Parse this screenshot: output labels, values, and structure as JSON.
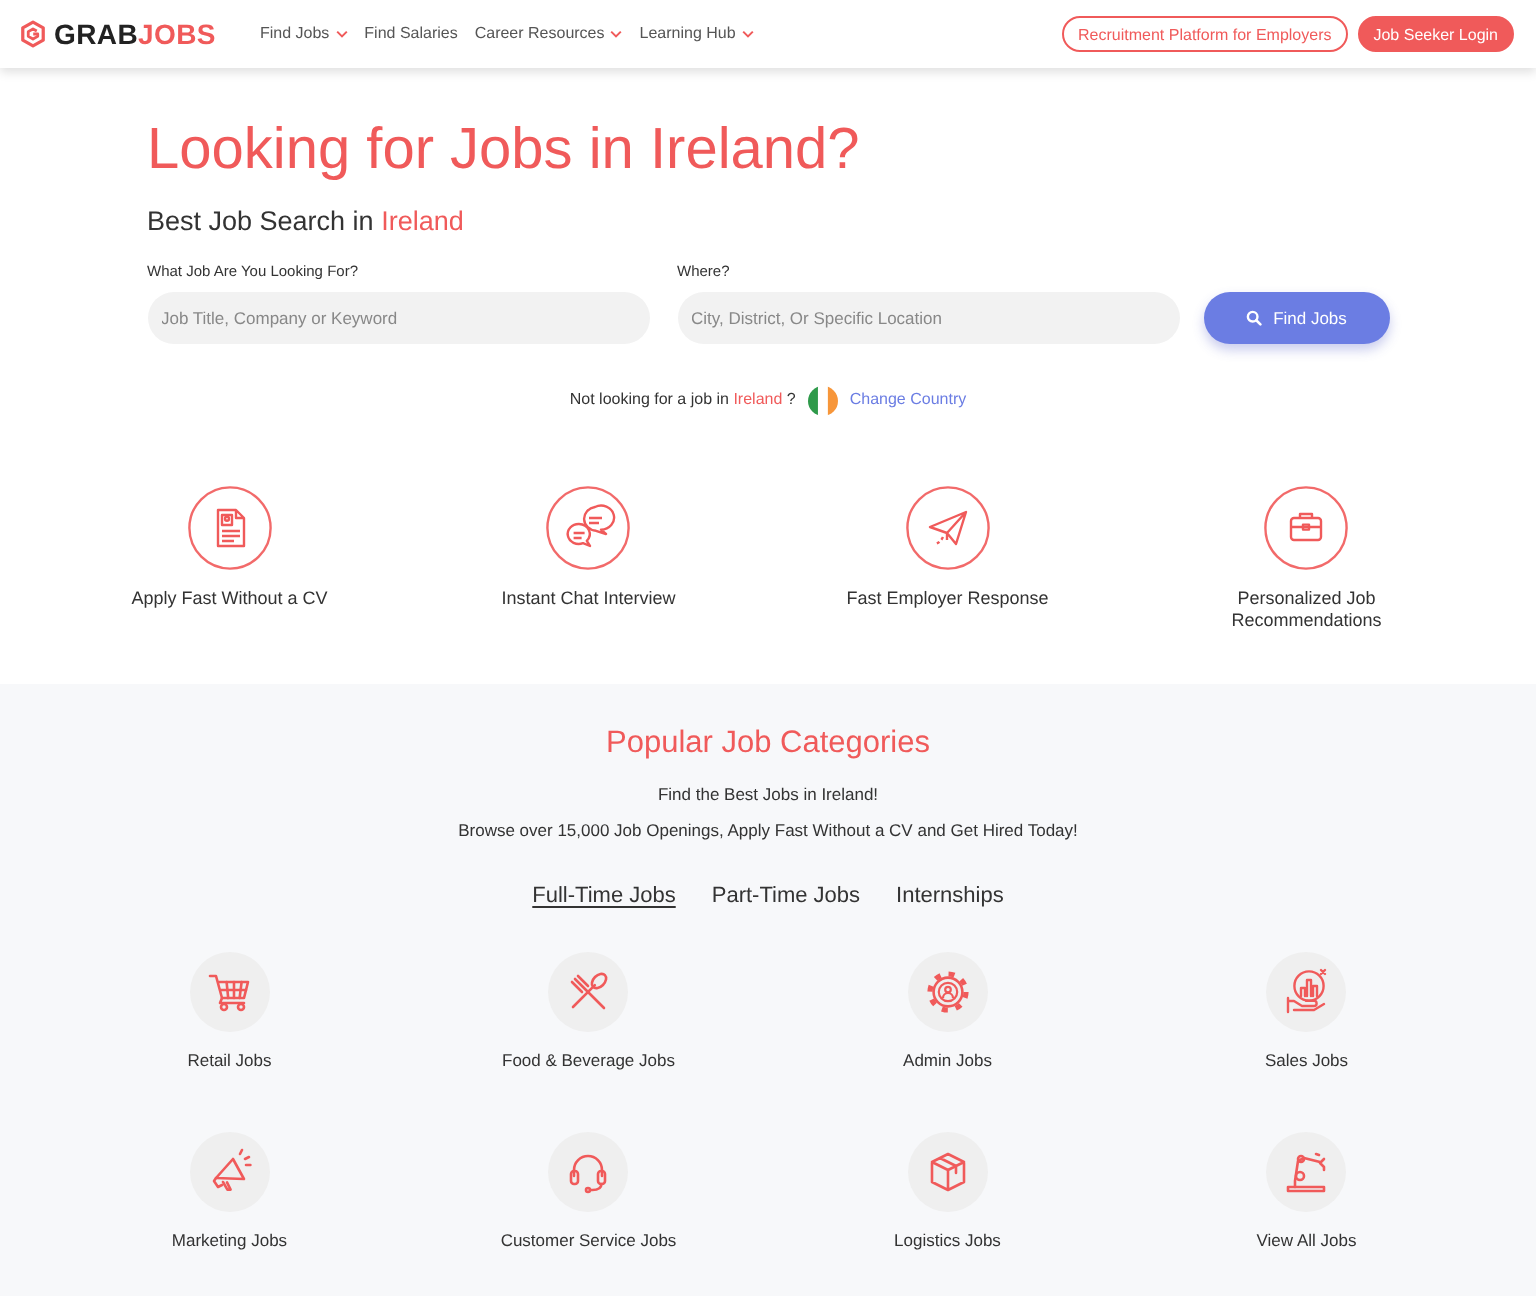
{
  "header": {
    "logo": {
      "text_primary": "GRAB",
      "text_accent": "JOBS"
    },
    "nav": [
      {
        "label": "Find Jobs",
        "dropdown": true
      },
      {
        "label": "Find Salaries",
        "dropdown": false
      },
      {
        "label": "Career Resources",
        "dropdown": true
      },
      {
        "label": "Learning Hub",
        "dropdown": true
      }
    ],
    "buttons": [
      {
        "label": "Recruitment Platform for Employers",
        "kind": "outline"
      },
      {
        "label": "Job Seeker Login",
        "kind": "filled"
      }
    ]
  },
  "hero": {
    "title": "Looking for Jobs in Ireland?",
    "subtitle": {
      "text": "Best Job Search in",
      "place": "Ireland"
    },
    "search": {
      "fields": [
        {
          "label": "What Job Are You Looking For?",
          "placeholder": "Job Title, Company or Keyword"
        },
        {
          "label": "Where?",
          "placeholder": "City, District, Or Specific Location"
        }
      ],
      "button": "Find Jobs"
    },
    "country_note": {
      "text": "Not looking for a job in",
      "country": "Ireland",
      "suffix": "?",
      "link": "Change Country"
    }
  },
  "features": [
    {
      "label": "Apply Fast Without a CV"
    },
    {
      "label": "Instant Chat Interview"
    },
    {
      "label": "Fast Employer Response"
    },
    {
      "label": "Personalized Job Recommendations"
    }
  ],
  "categories": {
    "title": "Popular Job Categories",
    "tagline": "Find the Best Jobs in Ireland!",
    "description": "Browse over 15,000 Job Openings, Apply Fast Without a CV and Get Hired Today!",
    "tabs": [
      {
        "label": "Full-Time Jobs",
        "selected": true
      },
      {
        "label": "Part-Time Jobs",
        "selected": false
      },
      {
        "label": "Internships",
        "selected": false
      }
    ],
    "items": [
      {
        "label": "Retail Jobs"
      },
      {
        "label": "Food & Beverage Jobs"
      },
      {
        "label": "Admin Jobs"
      },
      {
        "label": "Sales Jobs"
      },
      {
        "label": "Marketing Jobs"
      },
      {
        "label": "Customer Service Jobs"
      },
      {
        "label": "Logistics Jobs"
      },
      {
        "label": "View All Jobs"
      }
    ]
  }
}
